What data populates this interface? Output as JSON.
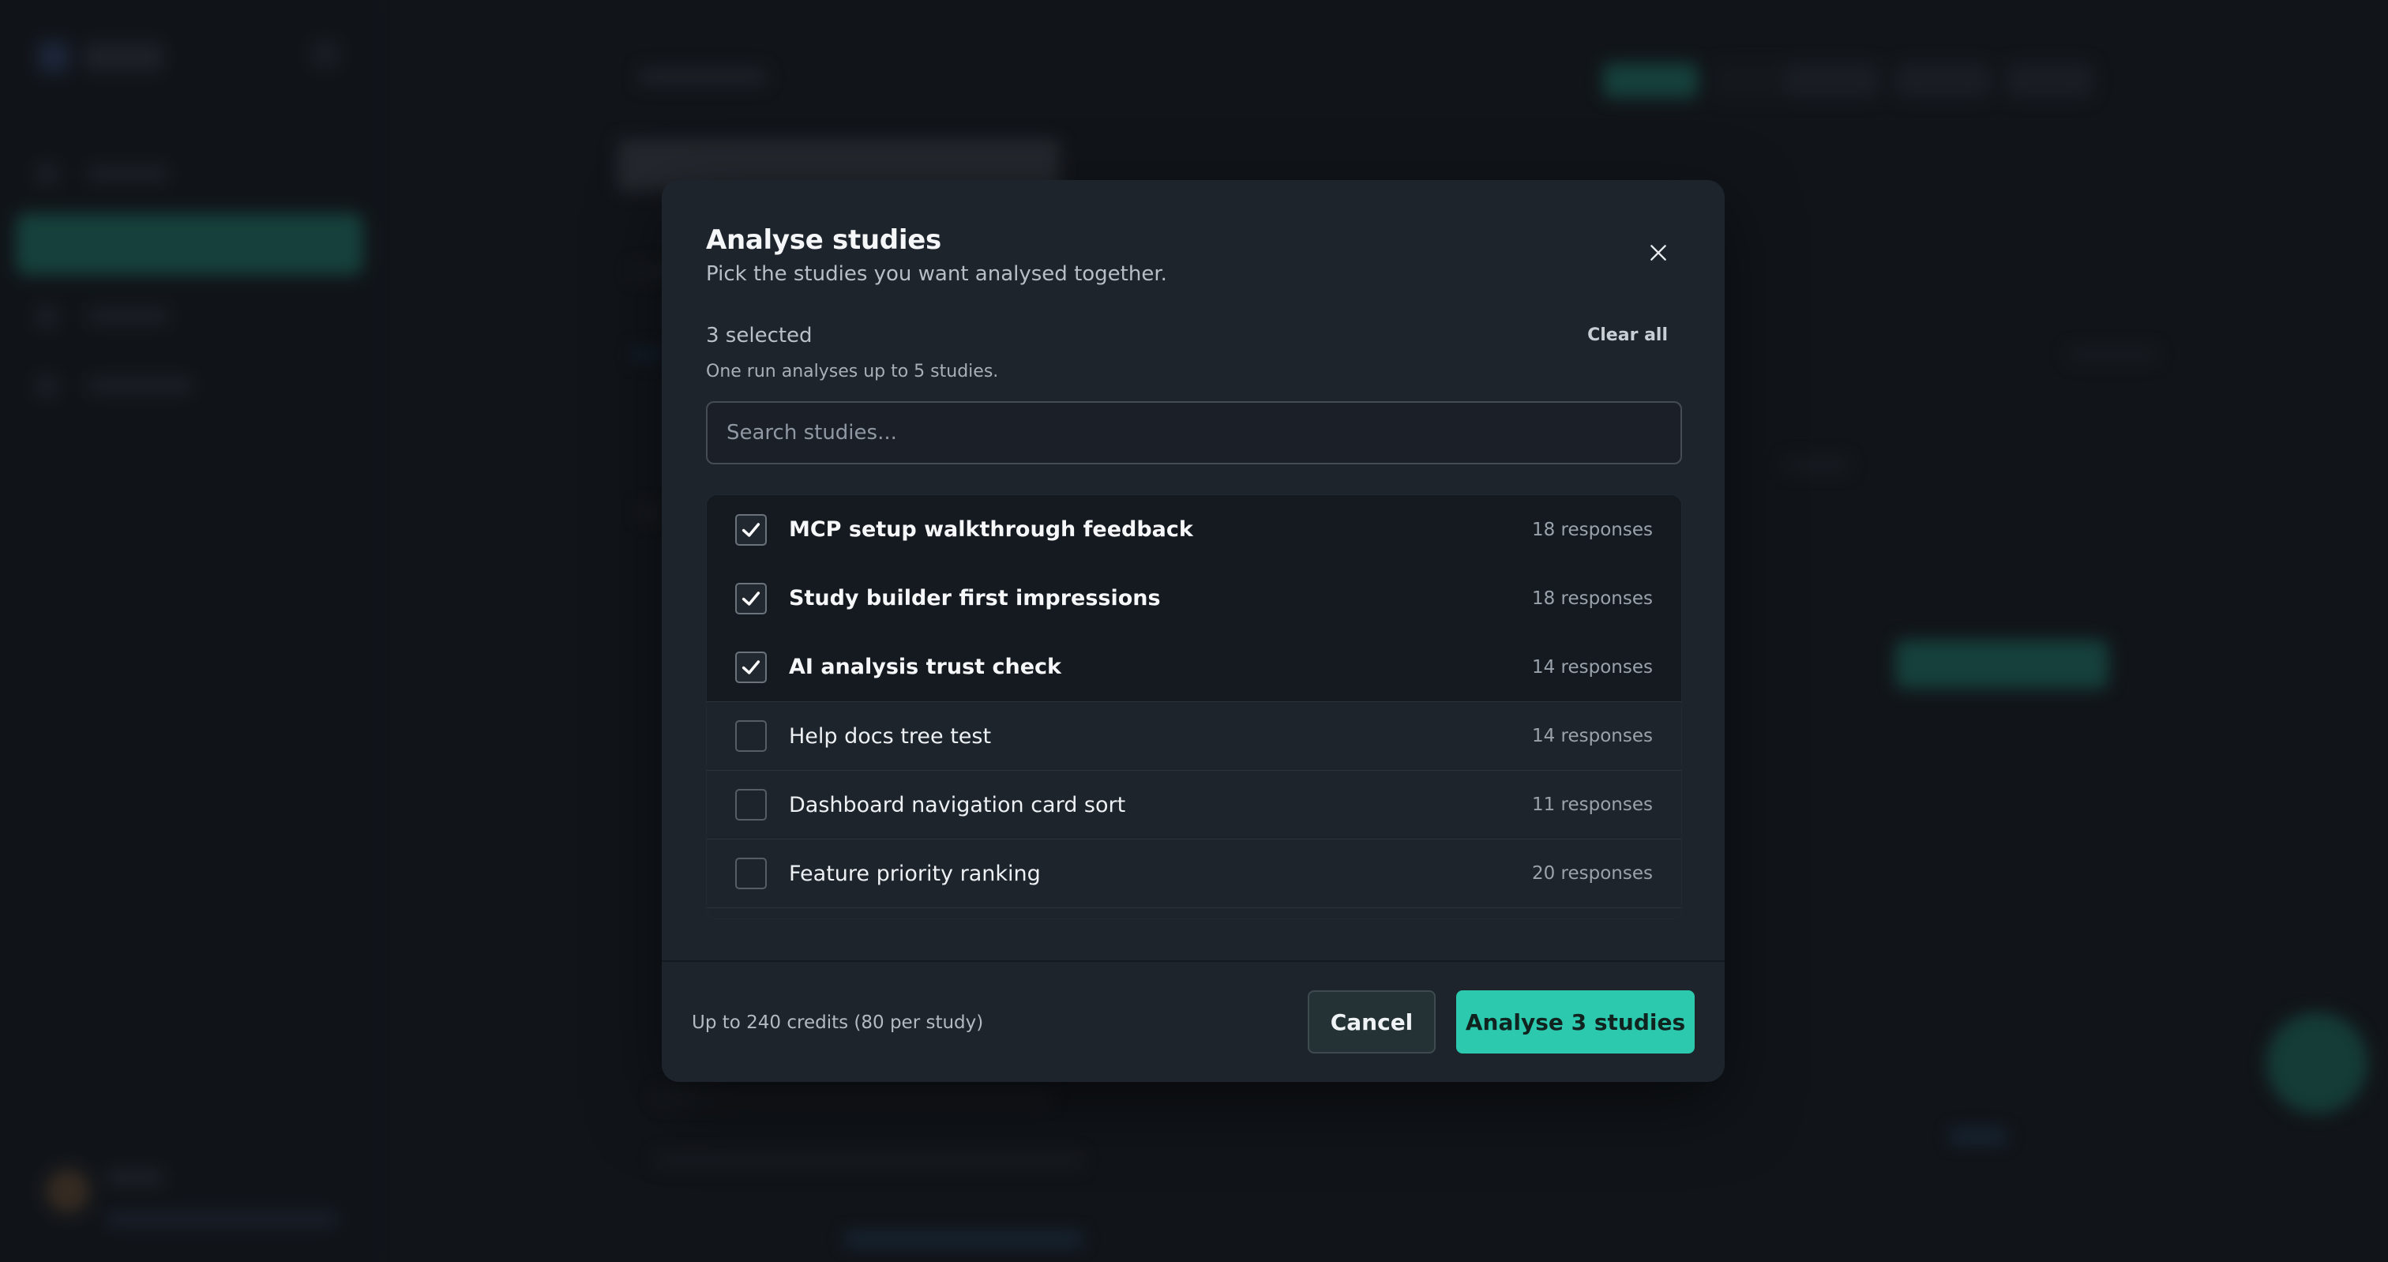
{
  "modal": {
    "title": "Analyse studies",
    "subtitle": "Pick the studies you want analysed together.",
    "selected_count": "3 selected",
    "clear_all_label": "Clear all",
    "limit_note": "One run analyses up to 5 studies.",
    "search_placeholder": "Search studies...",
    "studies": [
      {
        "name": "MCP setup walkthrough feedback",
        "responses": "18 responses",
        "checked": true
      },
      {
        "name": "Study builder first impressions",
        "responses": "18 responses",
        "checked": true
      },
      {
        "name": "AI analysis trust check",
        "responses": "14 responses",
        "checked": true
      },
      {
        "name": "Help docs tree test",
        "responses": "14 responses",
        "checked": false
      },
      {
        "name": "Dashboard navigation card sort",
        "responses": "11 responses",
        "checked": false
      },
      {
        "name": "Feature priority ranking",
        "responses": "20 responses",
        "checked": false
      }
    ],
    "footer": {
      "credits_note": "Up to 240 credits (80 per study)",
      "cancel_label": "Cancel",
      "analyse_label": "Analyse 3 studies"
    }
  },
  "colors": {
    "accent": "#2cc9af",
    "modal_bg": "#1e242c",
    "page_bg": "#161b21"
  },
  "icons": {
    "close": "close-icon",
    "check": "checkmark-icon"
  }
}
